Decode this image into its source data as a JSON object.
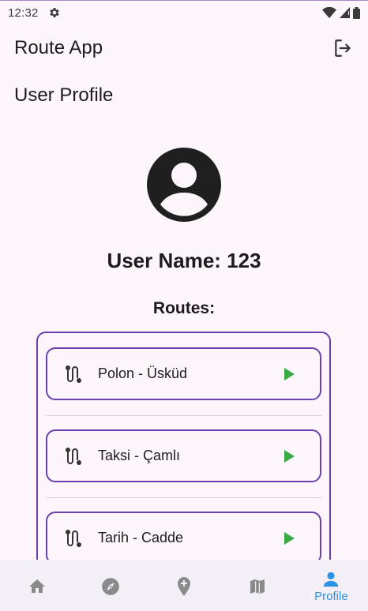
{
  "status_bar": {
    "time": "12:32"
  },
  "app_bar": {
    "title": "Route App"
  },
  "profile": {
    "section_title": "User Profile",
    "user_name": "User Name: 123",
    "routes_title": "Routes:"
  },
  "routes": [
    {
      "label": "Polon - Üsküd"
    },
    {
      "label": "Taksi - Çamlı"
    },
    {
      "label": "Tarih - Cadde"
    }
  ],
  "bottom_nav": {
    "active": "profile",
    "profile_label": "Profile",
    "active_color": "#2b93e3",
    "inactive_color": "#8a8a8a"
  },
  "colors": {
    "accent": "#6a3fb0",
    "play": "#3aa845",
    "background": "#fcf6fc"
  }
}
